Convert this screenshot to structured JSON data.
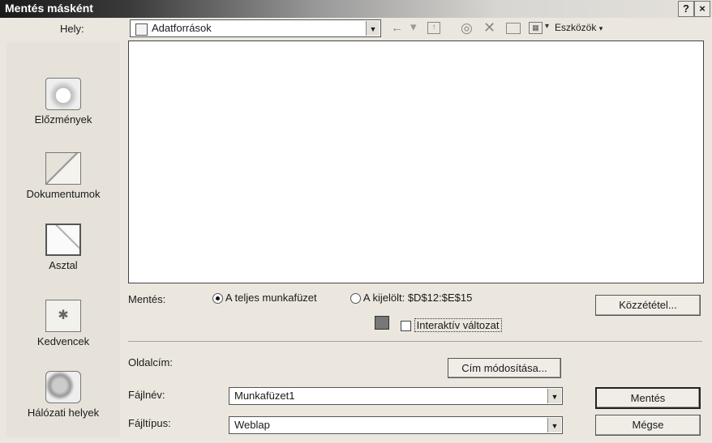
{
  "window": {
    "title": "Mentés másként",
    "help_label": "?",
    "close_label": "×"
  },
  "location": {
    "label": "Hely:",
    "value": "Adatforrások"
  },
  "toolbar": {
    "back_icon": "back-arrow-icon",
    "up_icon": "up-folder-icon",
    "search_icon": "search-web-icon",
    "delete_icon": "delete-icon",
    "new_folder_icon": "new-folder-icon",
    "views_icon": "views-icon",
    "tools_label": "Eszközök"
  },
  "places": [
    {
      "label": "Előzmények",
      "icon": "history-icon"
    },
    {
      "label": "Dokumentumok",
      "icon": "documents-icon"
    },
    {
      "label": "Asztal",
      "icon": "desktop-icon"
    },
    {
      "label": "Kedvencek",
      "icon": "favorites-icon"
    },
    {
      "label": "Hálózati helyek",
      "icon": "network-places-icon"
    }
  ],
  "save_options": {
    "label": "Mentés:",
    "option_whole": "A teljes munkafüzet",
    "option_selection": "A kijelölt: $D$12:$E$15",
    "selected": "whole",
    "interactive_label": "Interaktív változat",
    "interactive_checked": false
  },
  "publish_button": "Közzététel...",
  "page_title": {
    "label": "Oldalcím:",
    "change_button": "Cím módosítása..."
  },
  "filename": {
    "label": "Fájlnév:",
    "value": "Munkafüzet1"
  },
  "filetype": {
    "label": "Fájltípus:",
    "value": "Weblap"
  },
  "buttons": {
    "save": "Mentés",
    "cancel": "Mégse"
  }
}
